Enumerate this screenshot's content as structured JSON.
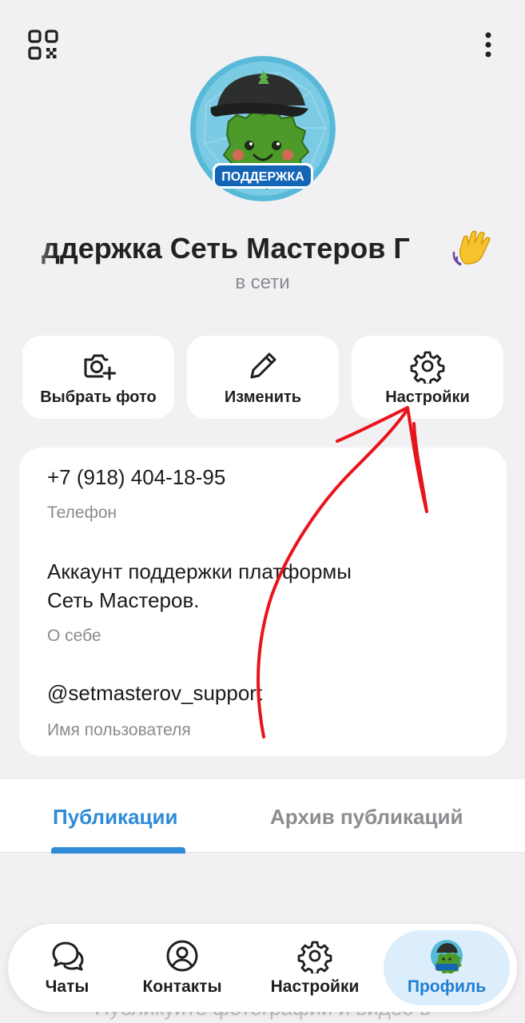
{
  "header": {
    "qr_icon": "qr-code-icon",
    "menu_icon": "more-vertical-icon"
  },
  "profile": {
    "avatar_badge": "ПОДДЕРЖКА",
    "name": "ддержка    Сеть Мастеров Г",
    "name_emoji": "waving-hand",
    "status": "в сети"
  },
  "actions": [
    {
      "label": "Выбрать фото",
      "icon": "add-photo-icon"
    },
    {
      "label": "Изменить",
      "icon": "pencil-icon"
    },
    {
      "label": "Настройки",
      "icon": "gear-icon"
    }
  ],
  "info": {
    "phone": "+7 (918) 404-18-95",
    "phone_label": "Телефон",
    "about_line1": "Аккаунт поддержки платформы",
    "about_line2": "Сеть Мастеров.",
    "about_label": "О себе",
    "username": "@setmasterov_support",
    "username_label": "Имя пользователя"
  },
  "tabs": {
    "active": "Публикации",
    "inactive": "Архив публикаций"
  },
  "empty_hint": "Публикуйте фотографии и видео в",
  "bottom_nav": [
    {
      "label": "Чаты",
      "icon": "chats-icon"
    },
    {
      "label": "Контакты",
      "icon": "contacts-icon"
    },
    {
      "label": "Настройки",
      "icon": "gear-icon"
    },
    {
      "label": "Профиль",
      "icon": "profile-avatar-icon",
      "active": true
    }
  ],
  "colors": {
    "accent": "#2f8bd8",
    "annotation": "#e8141b",
    "background": "#f1f1f3"
  }
}
